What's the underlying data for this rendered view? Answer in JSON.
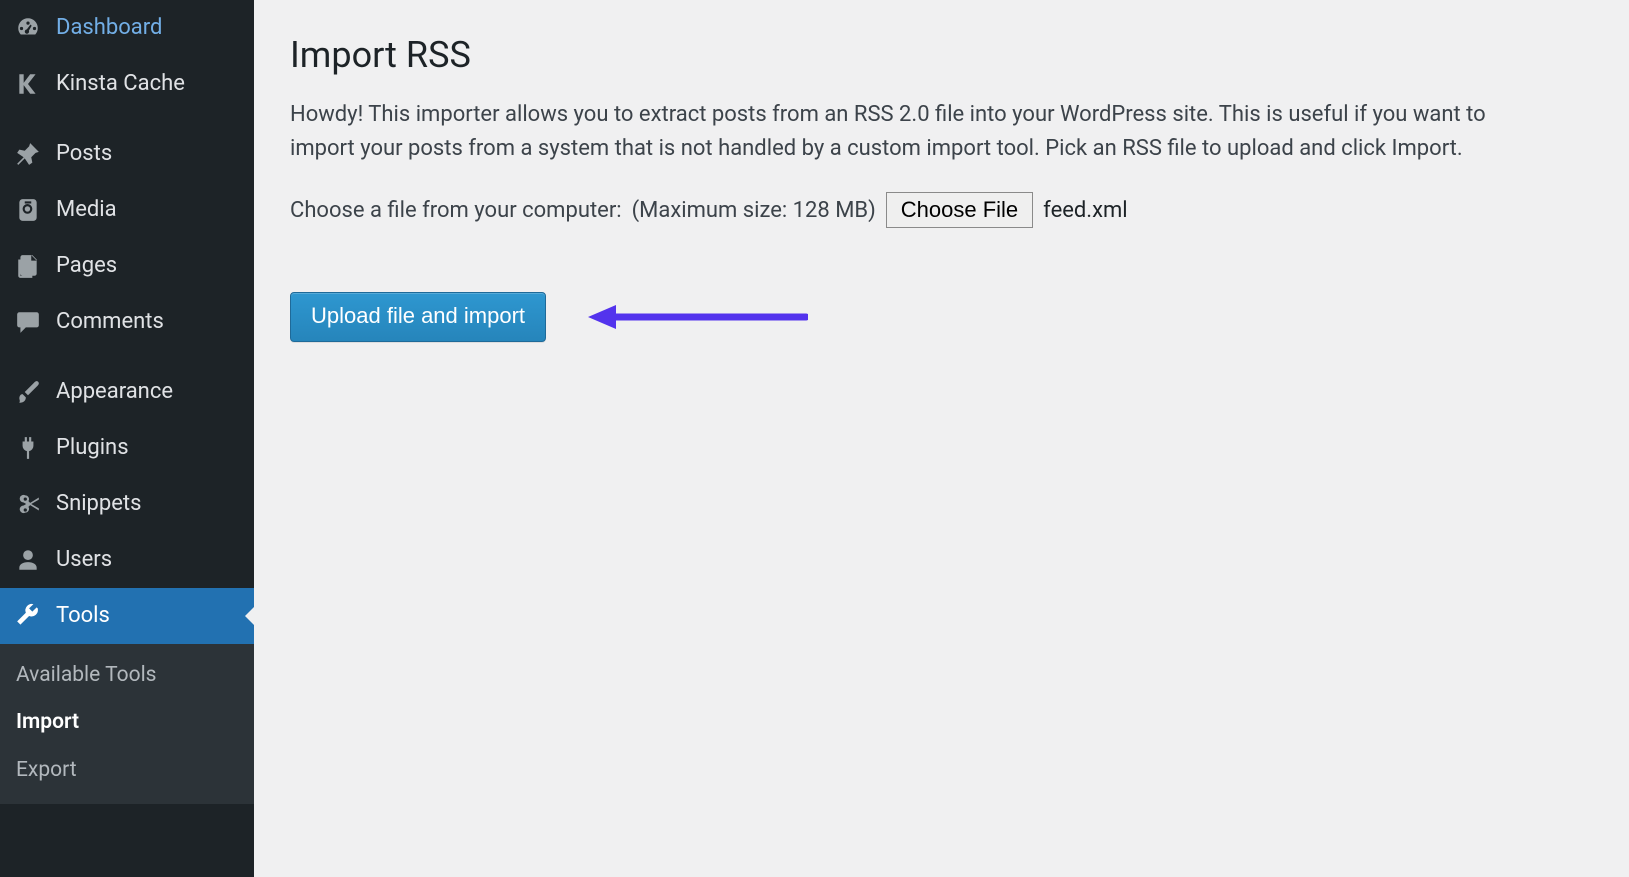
{
  "sidebar": {
    "items": [
      {
        "id": "dashboard",
        "label": "Dashboard",
        "icon": "dashboard-icon"
      },
      {
        "id": "kinsta",
        "label": "Kinsta Cache",
        "icon": "kinsta-icon"
      },
      {
        "id": "posts",
        "label": "Posts",
        "icon": "pin-icon"
      },
      {
        "id": "media",
        "label": "Media",
        "icon": "media-icon"
      },
      {
        "id": "pages",
        "label": "Pages",
        "icon": "pages-icon"
      },
      {
        "id": "comments",
        "label": "Comments",
        "icon": "comment-icon"
      },
      {
        "id": "appearance",
        "label": "Appearance",
        "icon": "brush-icon"
      },
      {
        "id": "plugins",
        "label": "Plugins",
        "icon": "plug-icon"
      },
      {
        "id": "snippets",
        "label": "Snippets",
        "icon": "scissors-icon"
      },
      {
        "id": "users",
        "label": "Users",
        "icon": "user-icon"
      },
      {
        "id": "tools",
        "label": "Tools",
        "icon": "wrench-icon",
        "current": true
      }
    ],
    "submenu": [
      {
        "id": "available",
        "label": "Available Tools"
      },
      {
        "id": "import",
        "label": "Import",
        "current": true
      },
      {
        "id": "export",
        "label": "Export"
      }
    ]
  },
  "page": {
    "title": "Import RSS",
    "intro": "Howdy! This importer allows you to extract posts from an RSS 2.0 file into your WordPress site. This is useful if you want to import your posts from a system that is not handled by a custom import tool. Pick an RSS file to upload and click Import.",
    "choose_label": "Choose a file from your computer:",
    "max_size_hint": "(Maximum size: 128 MB)",
    "choose_button": "Choose File",
    "chosen_filename": "feed.xml",
    "submit_button": "Upload file and import"
  },
  "colors": {
    "accent": "#2271b1",
    "annotation": "#5333ed"
  }
}
